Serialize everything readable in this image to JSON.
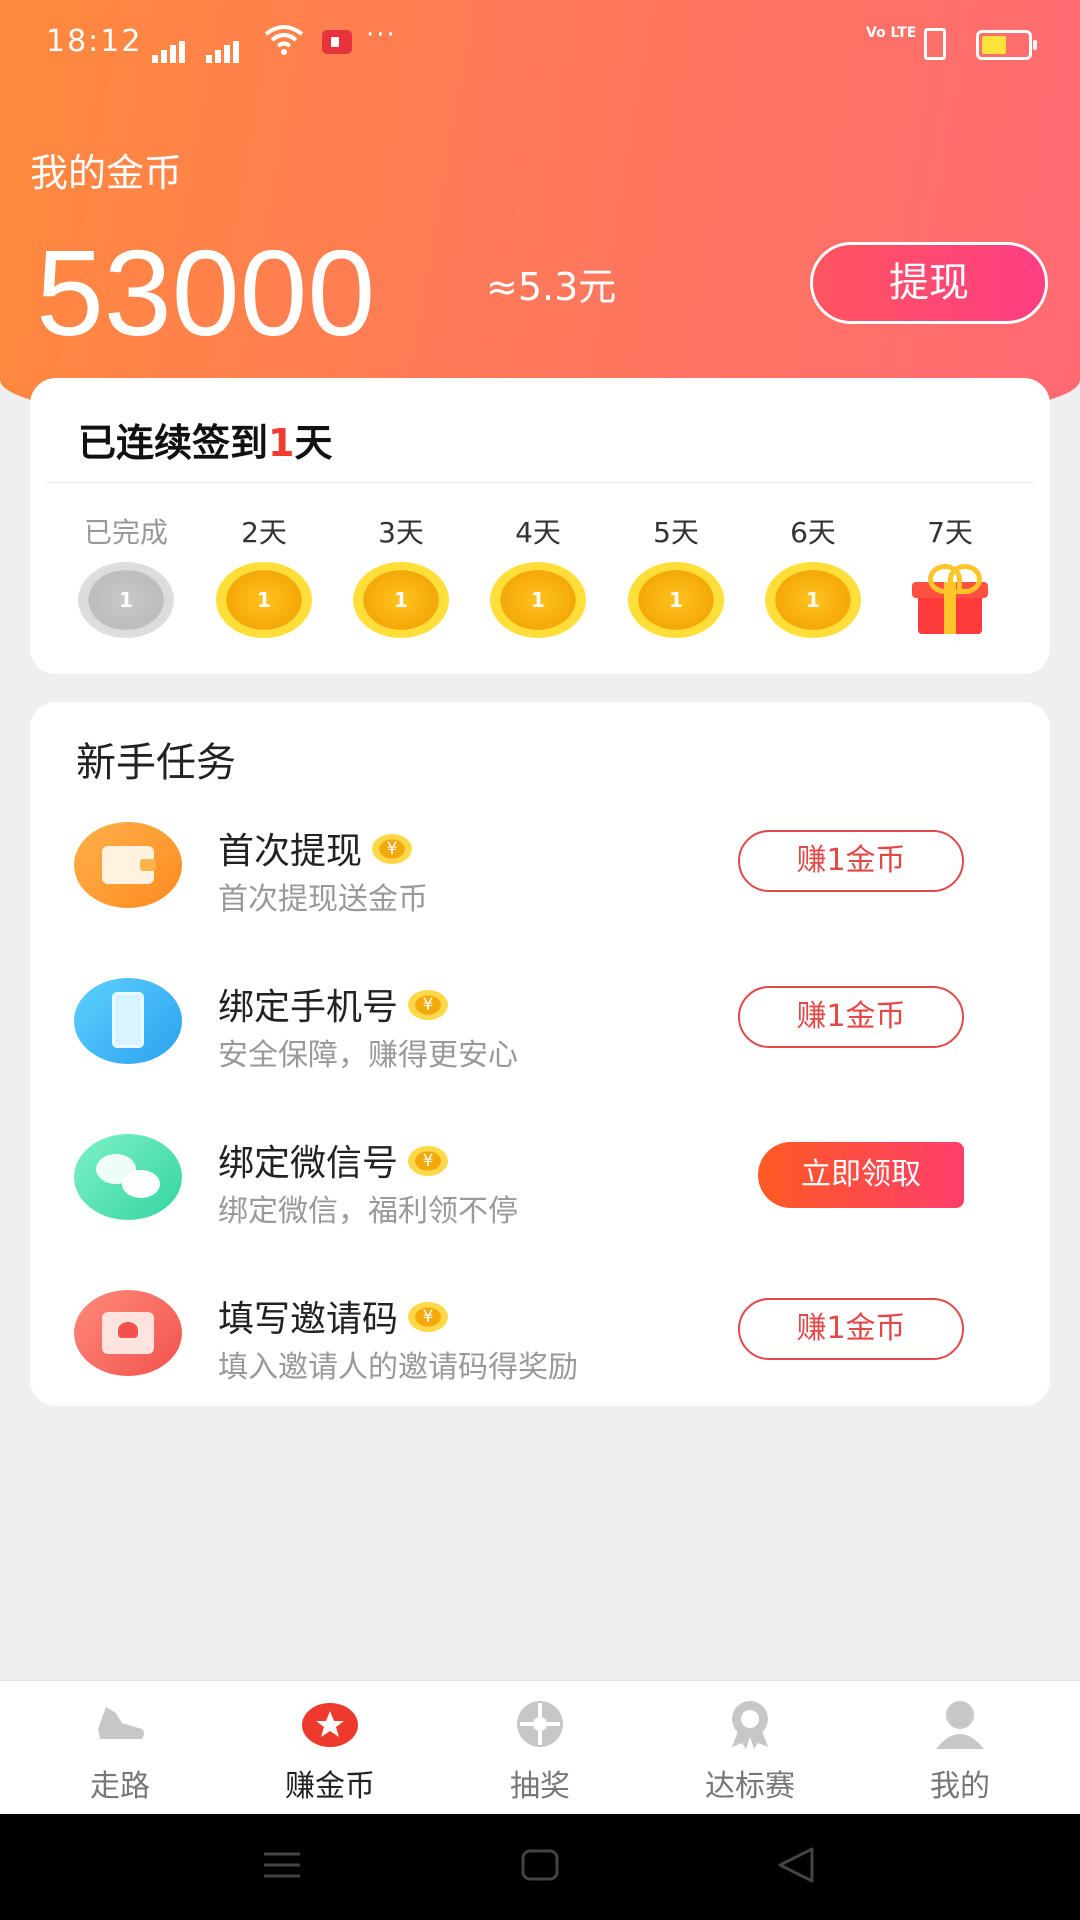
{
  "status_bar": {
    "time": "18:12",
    "dots": "···",
    "network": "Vo LTE"
  },
  "header": {
    "coins_label": "我的金币",
    "coins_amount": "53000",
    "coins_value": "≈5.3元",
    "withdraw_label": "提现"
  },
  "checkin": {
    "title_prefix": "已连续签到",
    "title_days": "1",
    "title_suffix": "天",
    "days": [
      {
        "label": "已完成",
        "coin": "1"
      },
      {
        "label": "2天",
        "coin": "1"
      },
      {
        "label": "3天",
        "coin": "1"
      },
      {
        "label": "4天",
        "coin": "1"
      },
      {
        "label": "5天",
        "coin": "1"
      },
      {
        "label": "6天",
        "coin": "1"
      },
      {
        "label": "7天"
      }
    ]
  },
  "tasks": {
    "title": "新手任务",
    "items": [
      {
        "name": "首次提现",
        "desc": "首次提现送金币",
        "button": "赚1金币"
      },
      {
        "name": "绑定手机号",
        "desc": "安全保障，赚得更安心",
        "button": "赚1金币"
      },
      {
        "name": "绑定微信号",
        "desc": "绑定微信，福利领不停",
        "button": "立即领取"
      },
      {
        "name": "填写邀请码",
        "desc": "填入邀请人的邀请码得奖励",
        "button": "赚1金币"
      }
    ]
  },
  "nav": {
    "items": [
      {
        "label": "走路",
        "icon": "shoe-icon"
      },
      {
        "label": "赚金币",
        "icon": "star-coin-icon"
      },
      {
        "label": "抽奖",
        "icon": "wheel-icon"
      },
      {
        "label": "达标赛",
        "icon": "medal-icon"
      },
      {
        "label": "我的",
        "icon": "person-icon"
      }
    ]
  },
  "colors": {
    "accent_orange": "#ff8a3c",
    "accent_pink": "#ff6a73",
    "highlight_red": "#f23b2f"
  }
}
